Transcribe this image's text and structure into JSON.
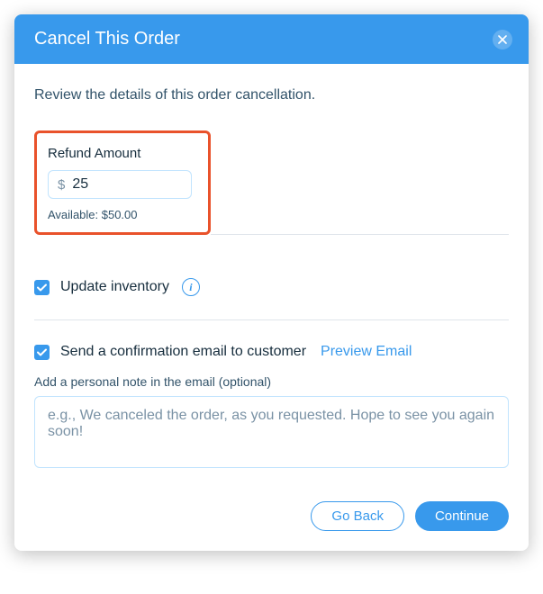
{
  "header": {
    "title": "Cancel This Order"
  },
  "body": {
    "review_text": "Review the details of this order cancellation.",
    "refund": {
      "label": "Refund Amount",
      "currency": "$",
      "value": "25",
      "available": "Available: $50.00"
    },
    "update_inventory": {
      "label": "Update inventory"
    },
    "confirmation_email": {
      "label": "Send a confirmation email to customer",
      "preview_link": "Preview Email",
      "note_label": "Add a personal note in the email (optional)",
      "note_placeholder": "e.g., We canceled the order, as you requested. Hope to see you again soon!"
    }
  },
  "footer": {
    "go_back": "Go Back",
    "continue": "Continue"
  }
}
